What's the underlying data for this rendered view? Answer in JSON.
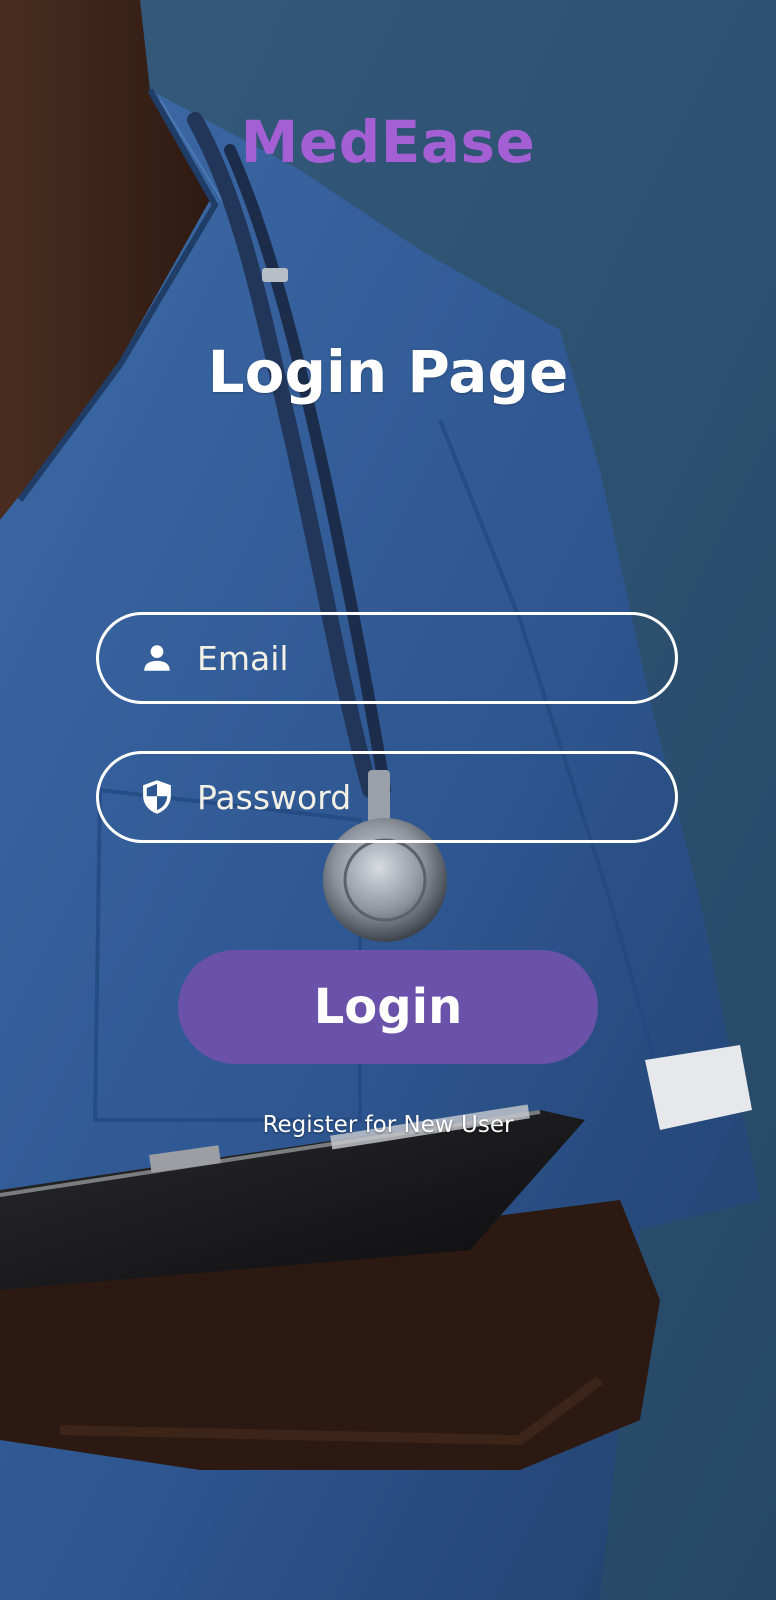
{
  "app": {
    "brand": "MedEase"
  },
  "header": {
    "title": "Login Page"
  },
  "form": {
    "email": {
      "placeholder": "Email",
      "value": "",
      "icon": "person-icon"
    },
    "password": {
      "placeholder": "Password",
      "value": "",
      "icon": "shield-icon"
    },
    "login_label": "Login",
    "register_label": "Register for New User"
  },
  "colors": {
    "brand": "#a35fd3",
    "button": "#6a51a9",
    "background": "#2f5478",
    "field_border": "#ffffff"
  }
}
